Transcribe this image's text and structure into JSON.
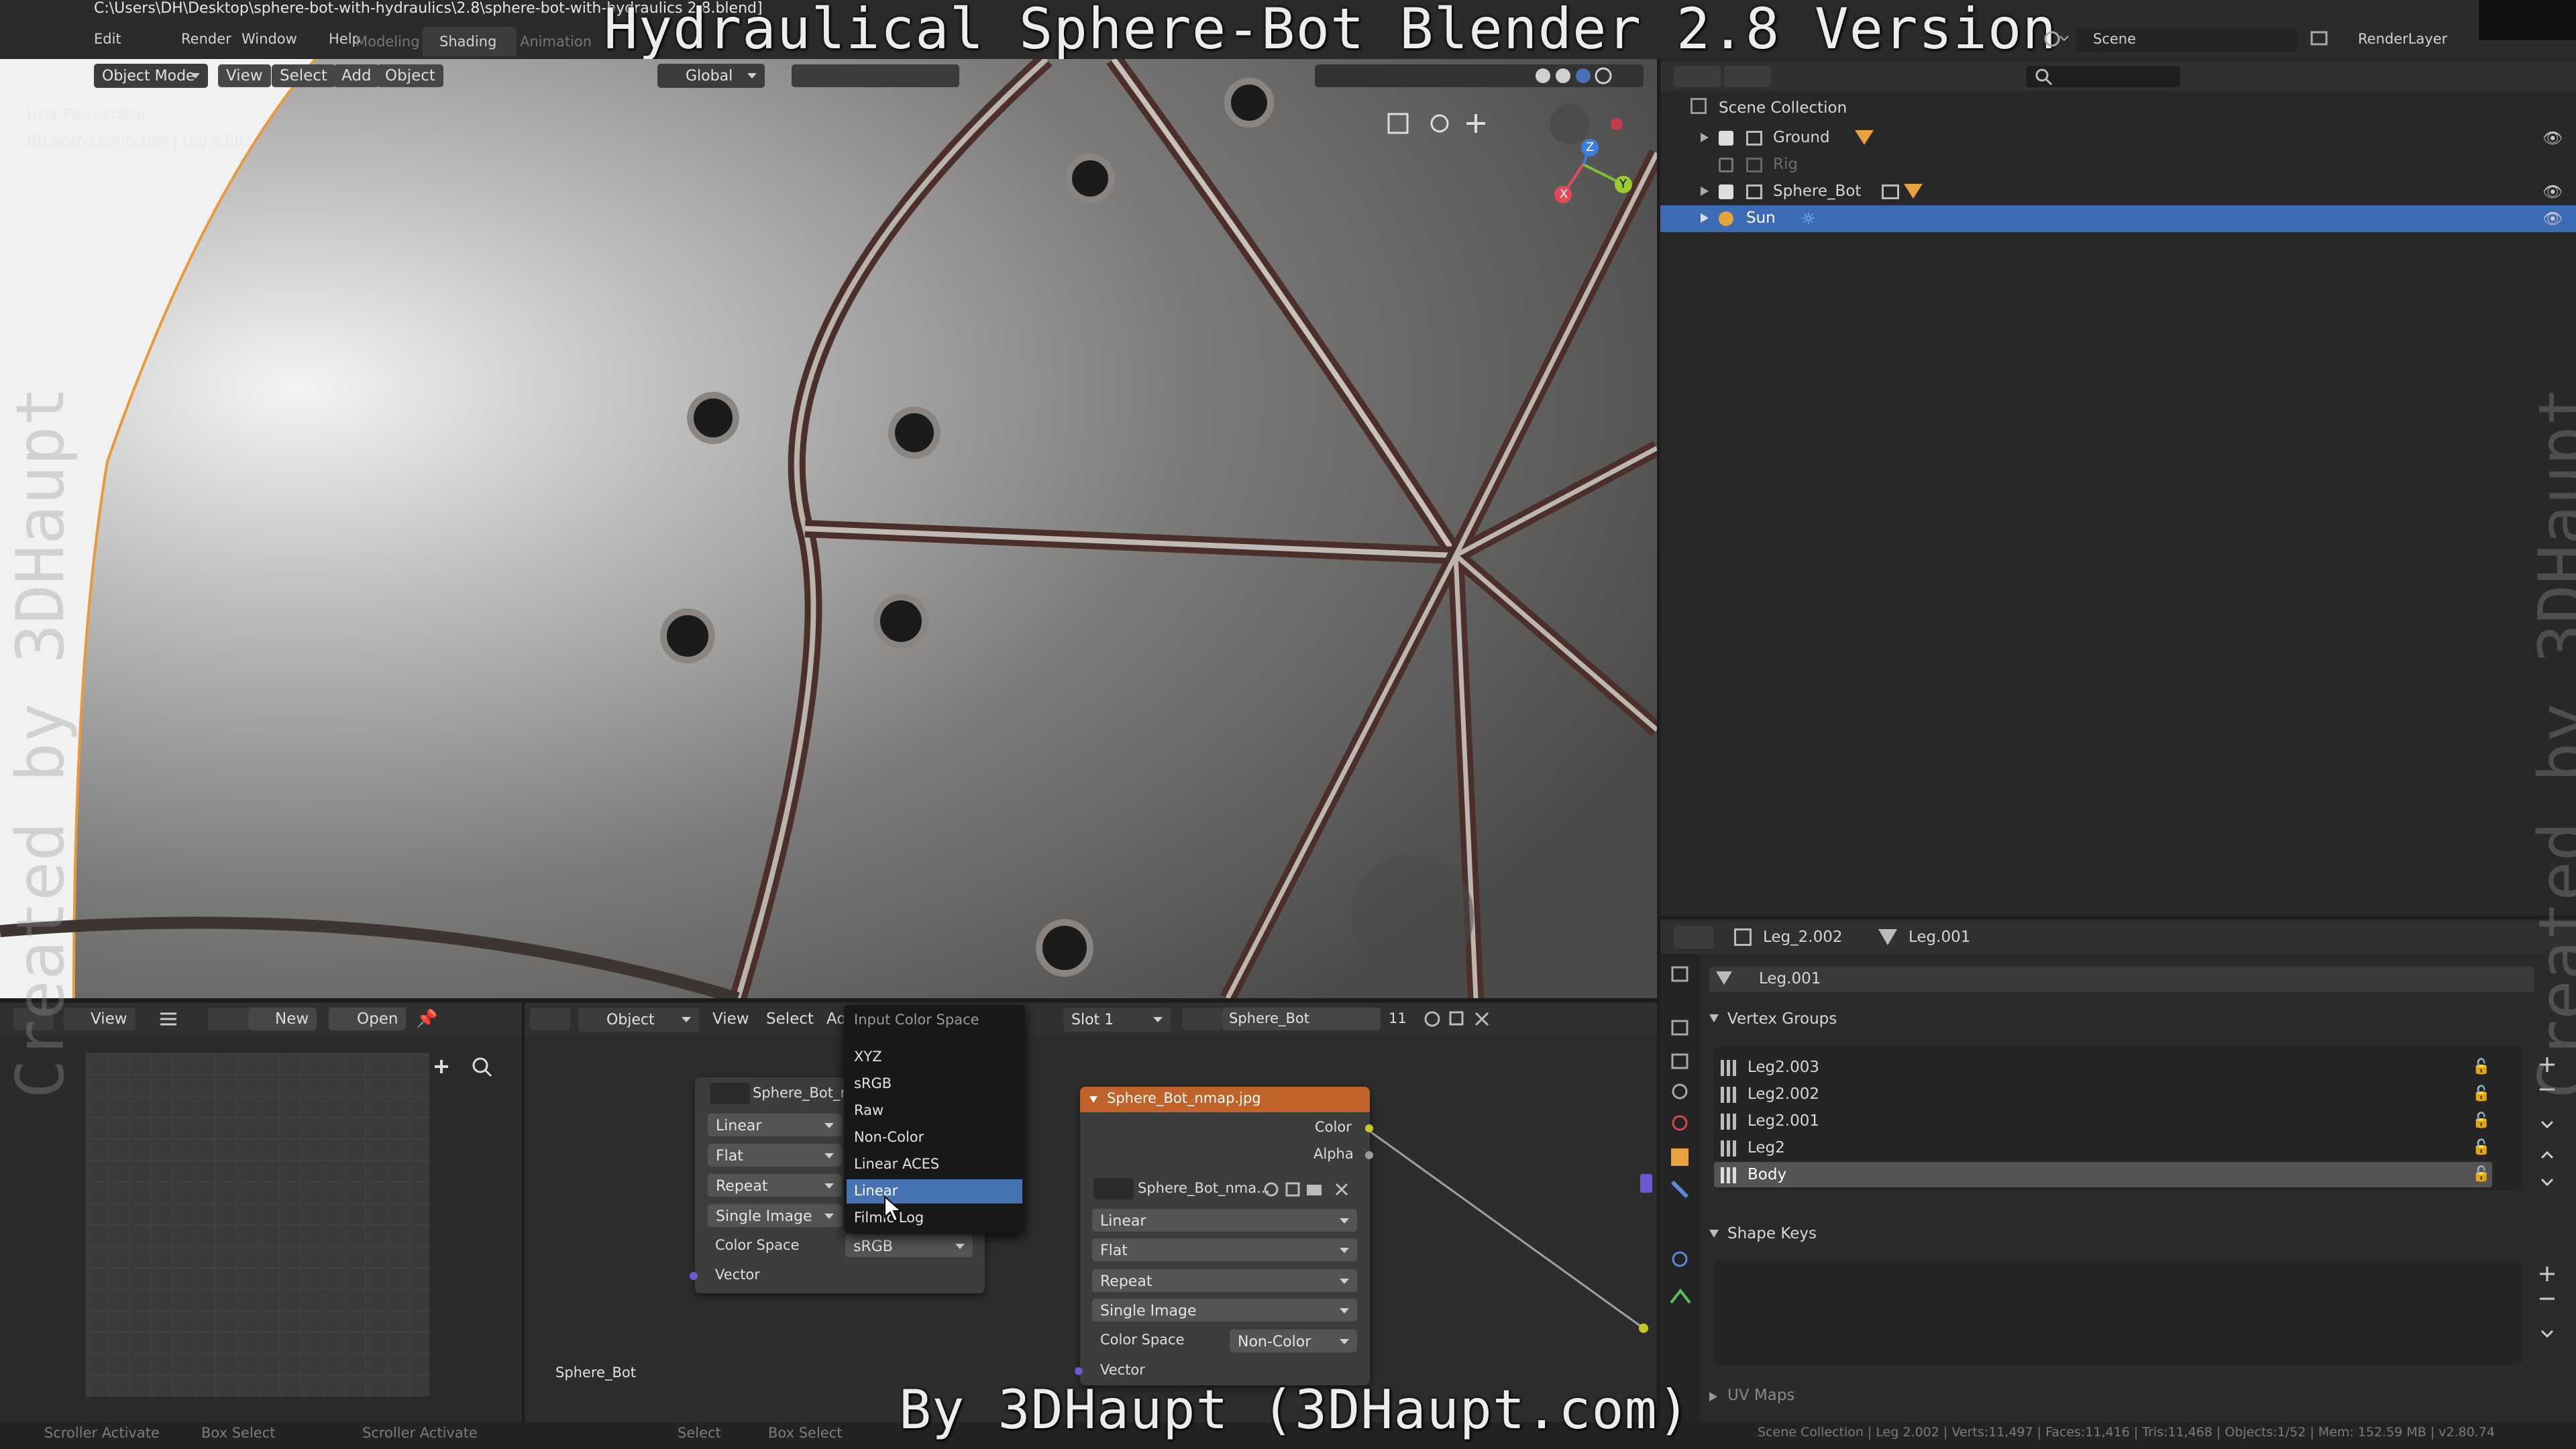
{
  "title_bar": {
    "path": "C:\\Users\\DH\\Desktop\\sphere-bot-with-hydraulics\\2.8\\sphere-bot-with-hydraulics 2.8.blend]"
  },
  "overlay": {
    "title": "Hydraulical Sphere-Bot Blender 2.8 Version",
    "credit": "By 3DHaupt (3DHaupt.com)",
    "watermark_left": "Created by 3DHaupt",
    "watermark_right": "Created by 3DHaupt"
  },
  "top_menu": [
    "Edit",
    "Render",
    "Window",
    "Help"
  ],
  "workspaces": [
    "Modeling",
    "Shading",
    "Animation"
  ],
  "scene_label": "Scene",
  "render_layer": "RenderLayer",
  "viewport": {
    "mode": "Object Mode",
    "menus": [
      "View",
      "Select",
      "Add",
      "Object"
    ],
    "transform": "Global",
    "info_line1": "User Perspective",
    "info_line2": "(0) Scene Collection | Leg 2.002",
    "gizmo": {
      "x": "X",
      "y": "Y",
      "z": "Z"
    }
  },
  "outliner": {
    "root": "Scene Collection",
    "items": [
      {
        "label": "Ground",
        "dim": false
      },
      {
        "label": "Rig",
        "dim": true
      },
      {
        "label": "Sphere_Bot",
        "dim": false
      },
      {
        "label": "Sun",
        "dim": false
      }
    ]
  },
  "properties": {
    "object": "Leg_2.002",
    "mesh": "Leg.001",
    "mesh_field": "Leg.001",
    "vertex_groups_title": "Vertex Groups",
    "vertex_groups": [
      "Leg2.003",
      "Leg2.002",
      "Leg2.001",
      "Leg2",
      "Body"
    ],
    "shape_keys_title": "Shape Keys",
    "uv_maps_title": "UV Maps"
  },
  "image_editor": {
    "menus": [
      "View"
    ],
    "new": "New",
    "open": "Open"
  },
  "node_editor": {
    "mode": "Object",
    "menus": [
      "View",
      "Select",
      "Add"
    ],
    "slot": "Slot 1",
    "material": "Sphere_Bot",
    "users": "11",
    "tree_label": "Sphere_Bot",
    "node1": {
      "image": "Sphere_Bot_ro",
      "interp": "Linear",
      "proj": "Flat",
      "ext": "Repeat",
      "source": "Single Image",
      "cs_label": "Color Space",
      "cs_value": "sRGB",
      "vector": "Vector"
    },
    "node2": {
      "title": "Sphere_Bot_nmap.jpg",
      "out_color": "Color",
      "out_alpha": "Alpha",
      "image": "Sphere_Bot_nma...",
      "interp": "Linear",
      "proj": "Flat",
      "ext": "Repeat",
      "source": "Single Image",
      "cs_label": "Color Space",
      "cs_value": "Non-Color",
      "vector": "Vector"
    },
    "dropdown": {
      "title": "Input Color Space",
      "options": [
        "XYZ",
        "sRGB",
        "Raw",
        "Non-Color",
        "Linear ACES",
        "Linear",
        "Filmic Log"
      ],
      "selected": "Linear"
    }
  },
  "status_bar": {
    "left": [
      "Scroller Activate",
      "Box Select",
      "Scroller Activate"
    ],
    "mid": [
      "Select",
      "Box Select"
    ],
    "right": "Scene Collection | Leg 2.002 | Verts:11,497 | Faces:11,416 | Tris:11,468 | Objects:1/52 | Mem: 152.59 MB | v2.80.74"
  },
  "colors": {
    "accent": "#4772b3",
    "node_header": "#c0632a",
    "selection": "#3d6cb6"
  }
}
